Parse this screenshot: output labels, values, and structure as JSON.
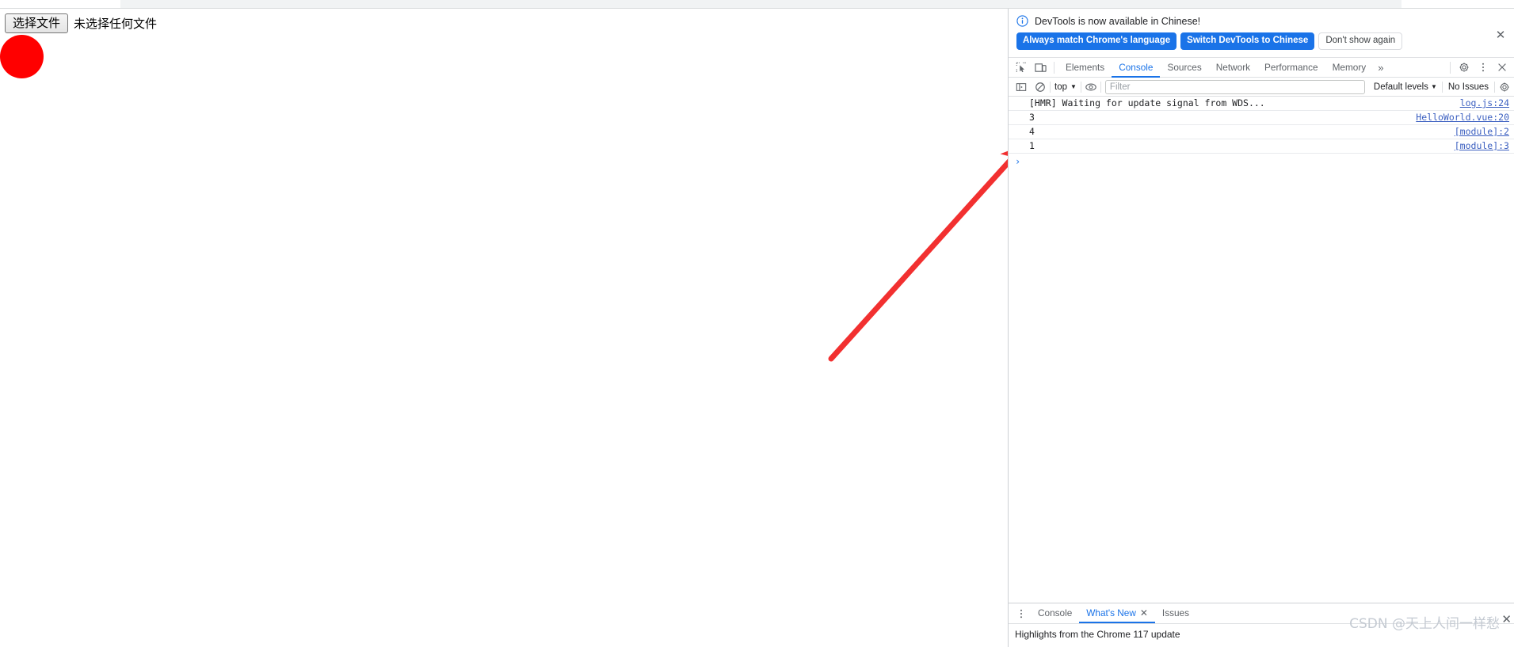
{
  "page": {
    "file_input": {
      "button_label": "选择文件",
      "status_text": "未选择任何文件"
    },
    "shape": {
      "name": "red-circle",
      "color": "#ff0000"
    },
    "annotation": {
      "name": "red-arrow",
      "color": "#f23030"
    }
  },
  "devtools": {
    "notice": {
      "message": "DevTools is now available in Chinese!",
      "icon": "info-icon",
      "buttons": [
        {
          "label": "Always match Chrome's language",
          "style": "primary"
        },
        {
          "label": "Switch DevTools to Chinese",
          "style": "primary"
        },
        {
          "label": "Don't show again",
          "style": "secondary"
        }
      ],
      "close_label": "✕"
    },
    "tabs": [
      {
        "label": "Elements",
        "active": false
      },
      {
        "label": "Console",
        "active": true
      },
      {
        "label": "Sources",
        "active": false
      },
      {
        "label": "Network",
        "active": false
      },
      {
        "label": "Performance",
        "active": false
      },
      {
        "label": "Memory",
        "active": false
      }
    ],
    "tabbar_overflow": "»",
    "tabbar_icons": {
      "inspect": "inspect-element-icon",
      "device": "device-toolbar-icon",
      "settings": "gear-icon",
      "more": "more-vertical-icon",
      "close": "close-icon"
    },
    "console_toolbar": {
      "sidebar_icon": "console-sidebar-icon",
      "clear_icon": "clear-console-icon",
      "context_value": "top",
      "context_caret": "▼",
      "eye_icon": "live-expression-icon",
      "filter_placeholder": "Filter",
      "filter_value": "",
      "levels_value": "Default levels",
      "levels_caret": "▼",
      "issues_label": "No Issues",
      "settings_icon": "gear-icon"
    },
    "console_messages": [
      {
        "text": "[HMR] Waiting for update signal from WDS...",
        "source": "log.js:24"
      },
      {
        "text": "3",
        "source": "HelloWorld.vue:20"
      },
      {
        "text": "4",
        "source": "[module]:2"
      },
      {
        "text": "1",
        "source": "[module]:3"
      }
    ],
    "prompt_glyph": "›",
    "drawer": {
      "more_icon": "more-vertical-icon",
      "tabs": [
        {
          "label": "Console",
          "active": false,
          "closable": false
        },
        {
          "label": "What's New",
          "active": true,
          "closable": true,
          "close_label": "✕"
        },
        {
          "label": "Issues",
          "active": false,
          "closable": false
        }
      ],
      "content_heading": "Highlights from the Chrome 117 update"
    },
    "watermark": {
      "text": "CSDN @天上人间一样愁",
      "close_label": "✕"
    }
  },
  "colors": {
    "accent": "#1a73e8",
    "red": "#ff0000",
    "arrow_red": "#f23030",
    "border": "#dddfe2",
    "text": "#202124",
    "muted": "#5f6368"
  }
}
